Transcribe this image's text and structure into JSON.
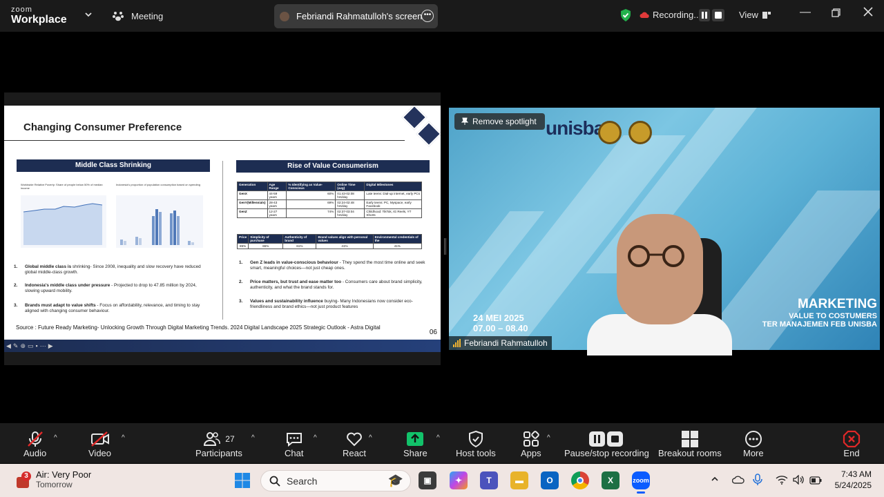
{
  "topbar": {
    "brand_top": "zoom",
    "brand_bottom": "Workplace",
    "meeting_label": "Meeting",
    "screen_share_label": "Febriandi Rahmatulloh's screen",
    "recording_label": "Recording...",
    "view_label": "View"
  },
  "slide": {
    "title": "Changing Consumer Preference",
    "left_header": "Middle Class Shrinking",
    "right_header": "Rise of Value Consumerism",
    "chart1_caption": "Worldwide Relative Poverty: Share of people below 50% of median income",
    "chart2_caption": "Indonesia's proportion of population consumption based on spending",
    "left_points": [
      {
        "num": "1.",
        "bold": "Global middle class is",
        "text": " shrinking- Since 2008, inequality and slow recovery have reduced global middle-class growth."
      },
      {
        "num": "2.",
        "bold": "Indonesia's middle class under pressure",
        "text": " -  Projected to drop to 47.85 million by 2024, slowing upward mobility."
      },
      {
        "num": "3.",
        "bold": "Brands must adapt to value shifts",
        "text": " - Focus on affordability, relevance, and timing to stay aligned with changing consumer behaviour."
      }
    ],
    "right_points": [
      {
        "num": "1.",
        "bold": "Gen Z leads in value-conscious behaviour",
        "text": " - They spend the most time online and seek smart, meaningful choices—not just cheap ones."
      },
      {
        "num": "2.",
        "bold": "Price matters, but trust and ease matter too",
        "text": " - Consumers care about brand simplicity, authenticity, and what the brand stands for."
      },
      {
        "num": "3.",
        "bold": "Values and sustainability influence",
        "text": " buying- Many Indonesians now consider eco-friendliness and brand ethics—not just product features"
      }
    ],
    "gen_table": {
      "headers": [
        "Generation",
        "Age Range",
        "% Identifying as Value-Conscious",
        "Online Time (avg)",
        "Digital Milestones"
      ],
      "rows": [
        [
          "GenX",
          "44-59 years",
          "60%",
          "01:43-02:08 hrs/day",
          "Late teens: Dial-up internet, early PCs"
        ],
        [
          "GenY(Millennials)",
          "28-43 years",
          "69%",
          "02:24-02:48 hrs/day",
          "Early teens: PC, Myspace, early Facebook"
        ],
        [
          "GenZ",
          "12-27 years",
          "74%",
          "02:37-03:04 hrs/day",
          "Childhood: TikTok, IG Reels, YT Shorts"
        ]
      ]
    },
    "price_table": {
      "headers": [
        "Price",
        "Simplicity of purchase",
        "Authenticity of brand",
        "Brand values align with personal values",
        "Environmental credentials of the"
      ],
      "values": [
        "85%",
        "65%",
        "61%",
        "41%",
        "41%"
      ]
    },
    "source": "Source : Future Ready Marketing- Unlocking Growth Through Digital Marketing Trends. 2024 Digital Landscape 2025 Strategic Outlook - Astra Digital",
    "page": "06"
  },
  "video": {
    "remove_spotlight": "Remove spotlight",
    "banner_brand": "unisba",
    "date_line1": "24 MEI 2025",
    "date_line2": "07.00 – 08.40",
    "marketing_title": "MARKETING",
    "marketing_sub1": "VALUE TO COSTUMERS",
    "marketing_sub2": "TER MANAJEMEN FEB UNISBA",
    "participant_name": "Febriandi Rahmatulloh"
  },
  "toolbar": {
    "audio": "Audio",
    "video": "Video",
    "participants": "Participants",
    "participants_count": "27",
    "chat": "Chat",
    "react": "React",
    "share": "Share",
    "host_tools": "Host tools",
    "apps": "Apps",
    "pause_stop": "Pause/stop recording",
    "breakout": "Breakout rooms",
    "more": "More",
    "end": "End"
  },
  "taskbar": {
    "weather_badge": "3",
    "weather_title": "Air: Very Poor",
    "weather_sub": "Tomorrow",
    "search_placeholder": "Search",
    "time": "7:43 AM",
    "date": "5/24/2025"
  },
  "colors": {
    "zoom_blue": "#0b5cff",
    "share_green": "#12c26a",
    "end_red": "#e02828",
    "slide_navy": "#1d2d52"
  }
}
